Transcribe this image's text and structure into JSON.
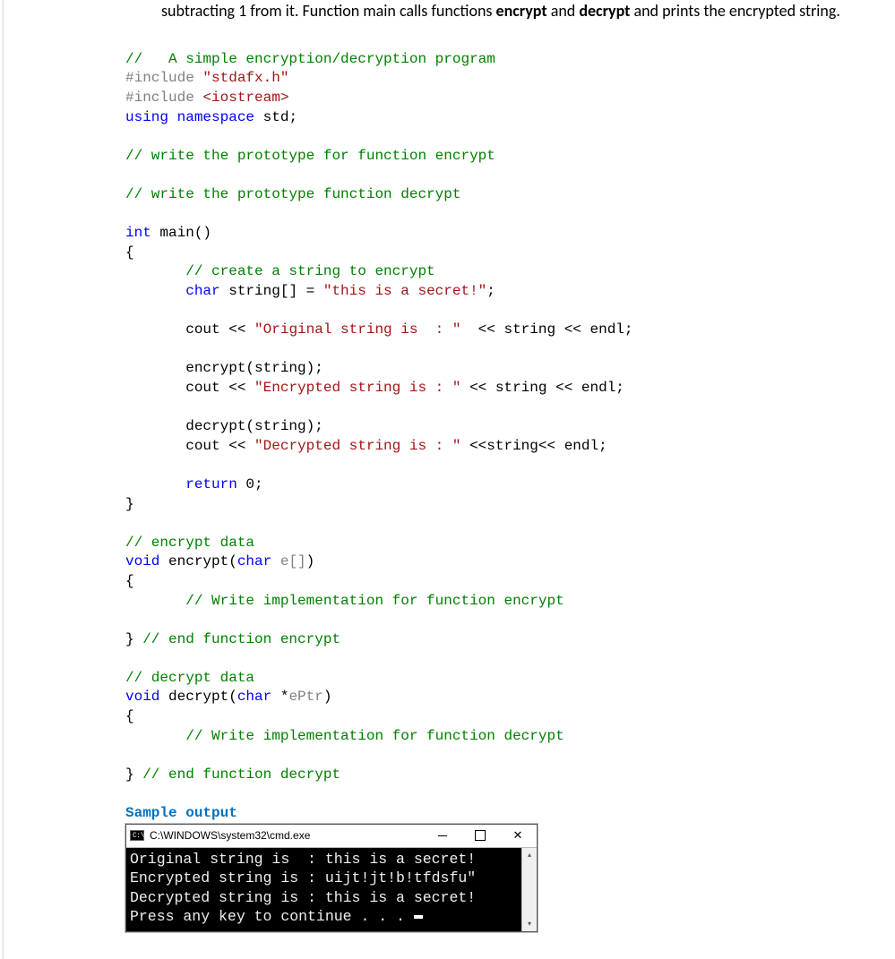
{
  "intro": {
    "pre": "subtracting 1 from it. Function main calls functions ",
    "b1": "encrypt",
    "mid1": " and ",
    "b2": "decrypt",
    "mid2": " and prints the encrypted string."
  },
  "code": {
    "l1_comment": "//   A simple encryption/decryption program",
    "l2_inc": "#include ",
    "l2_str": "\"stdafx.h\"",
    "l3_inc": "#include ",
    "l3_lib": "<iostream>",
    "l4_using": "using",
    "l4_ns": " namespace",
    "l4_std": " std",
    "l4_semi": ";",
    "l6_comment": "// write the prototype for function encrypt",
    "l8_comment": "// write the prototype function decrypt",
    "l10_int": "int",
    "l10_main": " main()",
    "l11_brace": "{",
    "l12_comment": "       // create a string to encrypt",
    "l13_pre": "       ",
    "l13_char": "char",
    "l13_var": " string[] = ",
    "l13_str": "\"this is a secret!\"",
    "l13_semi": ";",
    "l15_pre": "       cout << ",
    "l15_str": "\"Original string is  : \"",
    "l15_post": "  << string << endl;",
    "l17_enc": "       encrypt(string);",
    "l18_pre": "       cout << ",
    "l18_str": "\"Encrypted string is : \"",
    "l18_post": " << string << endl;",
    "l20_dec": "       decrypt(string);",
    "l21_pre": "       cout << ",
    "l21_str": "\"Decrypted string is : \"",
    "l21_post": " <<string<< endl;",
    "l23_pre": "       ",
    "l23_ret": "return",
    "l23_val": " 0;",
    "l24_brace": "}",
    "l26_comment": "// encrypt data",
    "l27_void": "void",
    "l27_fn": " encrypt(",
    "l27_char": "char",
    "l27_param": " e[]",
    "l27_close": ")",
    "l28_brace": "{",
    "l29_comment": "       // Write implementation for function encrypt",
    "l31_brace": "} ",
    "l31_comment": "// end function encrypt",
    "l33_comment": "// decrypt data",
    "l34_void": "void",
    "l34_fn": " decrypt(",
    "l34_char": "char",
    "l34_star": " *",
    "l34_param": "ePtr",
    "l34_close": ")",
    "l35_brace": "{",
    "l36_comment": "       // Write implementation for function decrypt",
    "l38_brace": "} ",
    "l38_comment": "// end function decrypt"
  },
  "sample_header": "Sample output",
  "console": {
    "title": "C:\\WINDOWS\\system32\\cmd.exe",
    "icon_text": "C:\\",
    "line1": "Original string is  : this is a secret!",
    "line2": "Encrypted string is : uijt!jt!b!tfdsfu\"",
    "line3": "Decrypted string is : this is a secret!",
    "line4": "Press any key to continue . . . "
  }
}
